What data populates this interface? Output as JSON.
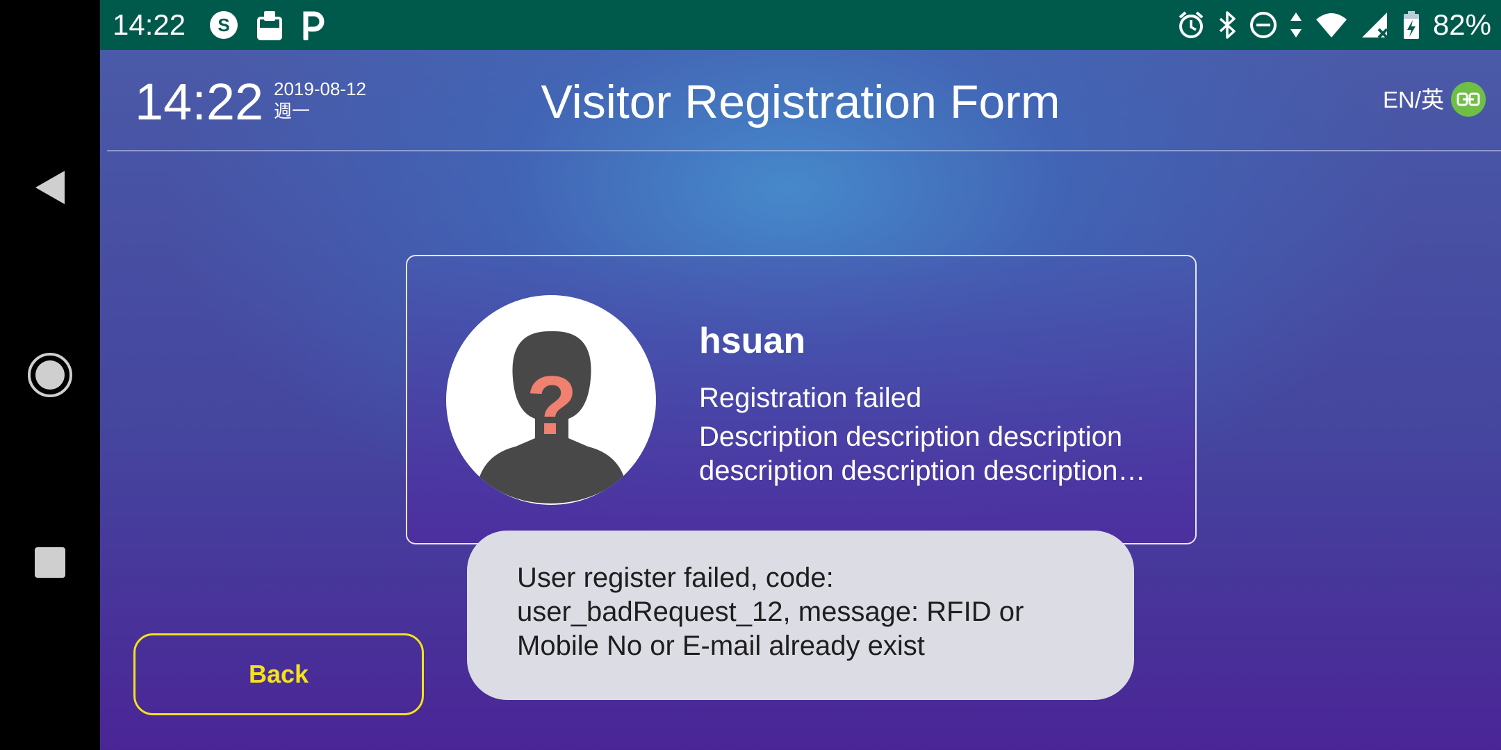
{
  "status_bar": {
    "time": "14:22",
    "battery_percent": "82%",
    "left_icons": [
      "sync-s-icon",
      "clipboard-icon",
      "parking-p-icon"
    ],
    "right_icons": [
      "alarm-icon",
      "bluetooth-icon",
      "do-not-disturb-icon",
      "data-arrows-icon",
      "wifi-icon",
      "cell-signal-icon",
      "battery-charging-icon"
    ]
  },
  "nav_bar": {
    "back": "back-triangle-icon",
    "home": "home-circle-icon",
    "recents": "recents-square-icon"
  },
  "header": {
    "clock": "14:22",
    "date": "2019-08-12",
    "weekday": "週一",
    "title": "Visitor Registration Form",
    "language": "EN/英",
    "language_icon": "link-icon"
  },
  "card": {
    "name": "hsuan",
    "status": "Registration failed",
    "description": "Description description description description description description description"
  },
  "back_button": {
    "label": "Back"
  },
  "toast": {
    "message": "User register failed, code: user_badRequest_12, message: RFID or Mobile No or E-mail already exist"
  },
  "colors": {
    "status_bar_bg": "#005a4c",
    "accent_yellow": "#f3e21c",
    "lang_icon_green": "#6fbe45",
    "question_mark": "#f08070"
  }
}
